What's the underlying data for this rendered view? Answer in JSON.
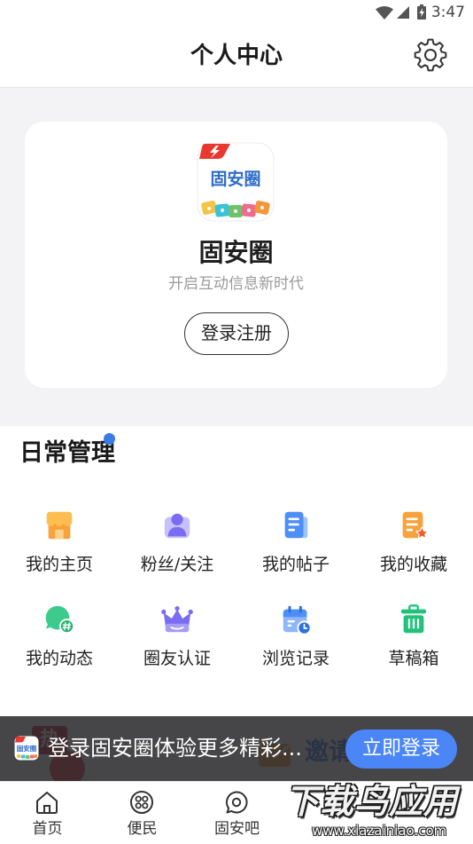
{
  "status_bar": {
    "time": "3:47",
    "icons": [
      "wifi-icon",
      "signal-icon",
      "battery-icon"
    ]
  },
  "header": {
    "title": "个人中心",
    "settings_icon": "gear-icon"
  },
  "profile_card": {
    "logo_text": "固安圈",
    "app_name": "固安圈",
    "slogan": "开启互动信息新时代",
    "login_button": "登录注册"
  },
  "daily_management": {
    "title": "日常管理",
    "items": [
      {
        "label": "我的主页",
        "icon": "store-icon"
      },
      {
        "label": "粉丝/关注",
        "icon": "fans-icon"
      },
      {
        "label": "我的帖子",
        "icon": "posts-icon"
      },
      {
        "label": "我的收藏",
        "icon": "favorites-icon"
      },
      {
        "label": "我的动态",
        "icon": "moments-icon"
      },
      {
        "label": "圈友认证",
        "icon": "crown-icon"
      },
      {
        "label": "浏览记录",
        "icon": "history-icon"
      },
      {
        "label": "草稿箱",
        "icon": "drafts-icon"
      }
    ]
  },
  "feature_cards": {
    "hot_badge": "热",
    "invite_title": "邀请"
  },
  "login_banner": {
    "logo_text": "固安圈",
    "text": "登录固安圈体验更多精彩...",
    "button": "立即登录"
  },
  "bottom_nav": {
    "items": [
      {
        "label": "首页",
        "icon": "home-icon"
      },
      {
        "label": "便民",
        "icon": "convenience-icon"
      },
      {
        "label": "固安吧",
        "icon": "forum-icon"
      }
    ]
  },
  "watermark": {
    "title": "下载鸟应用",
    "url": "www.xiazainiao.com"
  },
  "colors": {
    "accent": "#4a86f7",
    "notice_dot": "#3b7be6",
    "page_background": "#f3f3f5",
    "banner_background": "#28282a"
  }
}
